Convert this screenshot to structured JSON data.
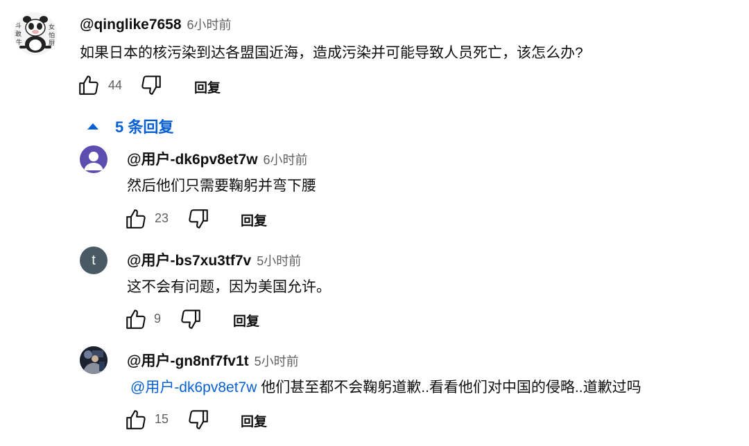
{
  "main_comment": {
    "handle": "@qinglike7658",
    "time": "6小时前",
    "text": "如果日本的核污染到达各盟国近海，造成污染并可能导致人员死亡，该怎么办?",
    "likes": "44",
    "reply_label": "回复",
    "avatar_icon": "panda-cow-avatar",
    "avatar_chars": [
      "敢",
      "牛",
      "怕",
      "厨",
      "女",
      "斗"
    ]
  },
  "replies_toggle": {
    "label": "5 条回复",
    "icon": "caret-up-icon",
    "color": "#065fd4"
  },
  "replies": [
    {
      "handle": "@用户-dk6pv8et7w",
      "time": "6小时前",
      "mention": "",
      "text": "然后他们只需要鞠躬并弯下腰",
      "likes": "23",
      "reply_label": "回复",
      "avatar_icon": "person-placeholder-avatar",
      "avatar_color": "#5c4db1"
    },
    {
      "handle": "@用户-bs7xu3tf7v",
      "time": "5小时前",
      "mention": "",
      "text": "这不会有问题，因为美国允许。",
      "likes": "9",
      "reply_label": "回复",
      "avatar_icon": "letter-avatar",
      "avatar_letter": "t",
      "avatar_color": "#4a5a64"
    },
    {
      "handle": "@用户-gn8nf7fv1t",
      "time": "5小时前",
      "mention": "@用户-dk6pv8et7w",
      "text": "他们甚至都不会鞠躬道歉..看看他们对中国的侵略..道歉过吗",
      "likes": "15",
      "reply_label": "回复",
      "avatar_icon": "photo-avatar"
    }
  ]
}
